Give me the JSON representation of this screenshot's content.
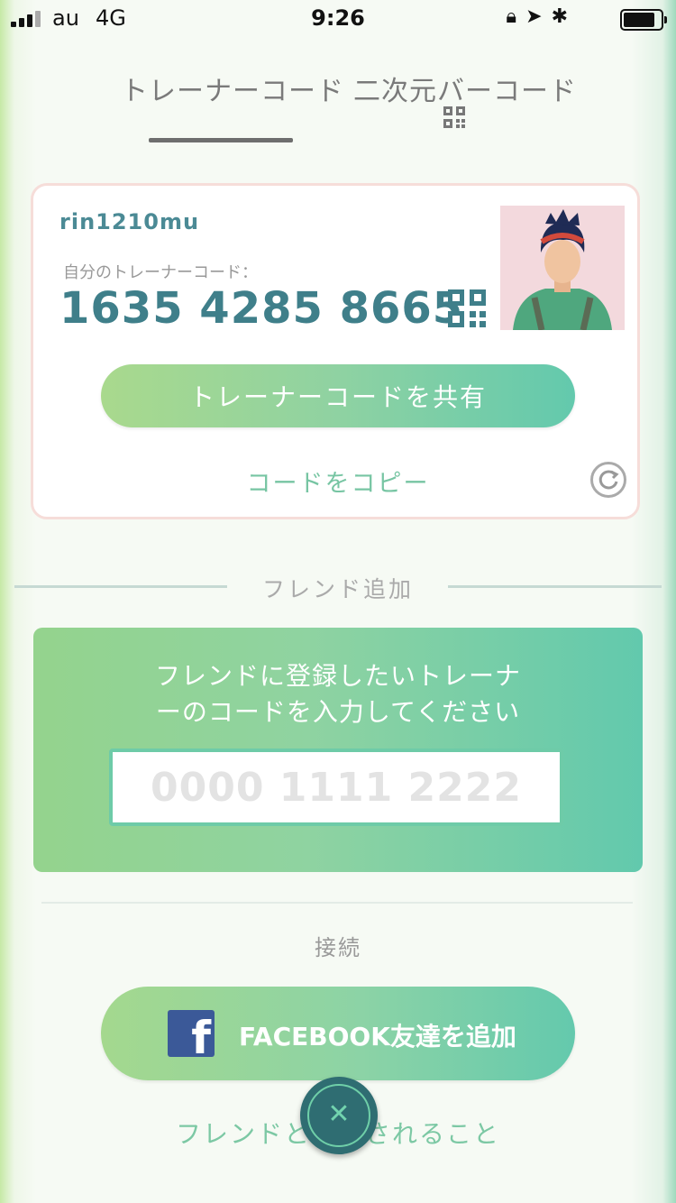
{
  "status_bar": {
    "carrier": "au",
    "network": "4G",
    "time": "9:26"
  },
  "tabs": [
    {
      "label": "トレーナーコード",
      "active": true
    },
    {
      "label": "二次元バーコード",
      "active": false,
      "icon": "qr-code-icon"
    }
  ],
  "card": {
    "username": "rin1210mu",
    "code_label": "自分のトレーナーコード：",
    "trainer_code": "1635 4285 8665",
    "share_button": "トレーナーコードを共有",
    "copy_link": "コードをコピー",
    "refresh_icon": "refresh-icon"
  },
  "add_friend": {
    "heading": "フレンド追加",
    "prompt_line1": "フレンドに登録したいトレーナ",
    "prompt_line2": "ーのコードを入力してください",
    "input_placeholder": "0000 1111 2222"
  },
  "connect": {
    "label": "接続",
    "facebook_button": "FACEBOOK友達を追加"
  },
  "bottom_link": "フレンドと　　されること",
  "colors": {
    "accent_green": "#6ecba8",
    "teal_text": "#3f7f8a",
    "close_button": "#2f6d72",
    "facebook_blue": "#3b5998"
  }
}
